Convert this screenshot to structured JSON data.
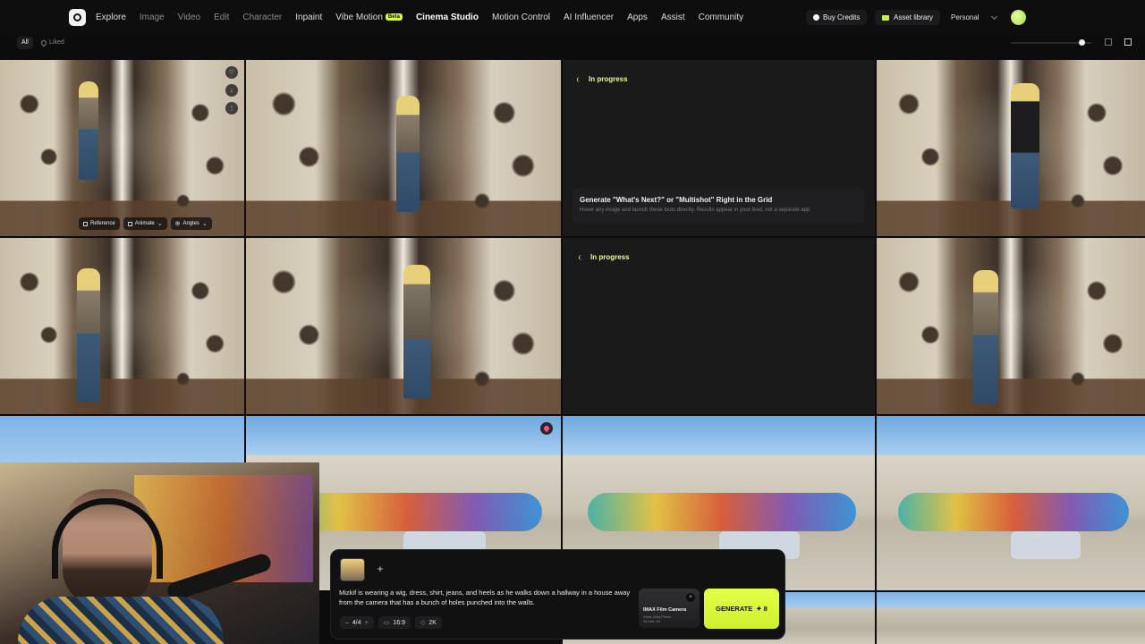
{
  "nav": {
    "items": [
      {
        "label": "Explore",
        "style": "strong"
      },
      {
        "label": "Image",
        "style": "muted"
      },
      {
        "label": "Video",
        "style": "muted"
      },
      {
        "label": "Edit",
        "style": "muted"
      },
      {
        "label": "Character",
        "style": "muted"
      },
      {
        "label": "Inpaint",
        "style": "strong"
      },
      {
        "label": "Vibe Motion",
        "style": "strong",
        "badge": "Beta"
      },
      {
        "label": "Cinema Studio",
        "style": "active"
      },
      {
        "label": "Motion Control",
        "style": "strong"
      },
      {
        "label": "AI Influencer",
        "style": "strong"
      },
      {
        "label": "Apps",
        "style": "strong"
      },
      {
        "label": "Assist",
        "style": "strong"
      },
      {
        "label": "Community",
        "style": "strong"
      }
    ],
    "buy_credits": "Buy Credits",
    "asset_library": "Asset library",
    "workspace": "Personal",
    "accent_color": "#d7ff3a"
  },
  "filters": {
    "all": "All",
    "liked": "Liked"
  },
  "grid": {
    "hover_tools": {
      "reference": "Reference",
      "animate": "Animate",
      "angles": "Angles"
    },
    "in_progress_label": "In progress",
    "tip": {
      "title": "Generate \"What's Next?\" or \"Multishot\" Right in the Grid",
      "subtitle": "Hover any image and launch these tools directly. Results appear in your feed, not a separate app"
    }
  },
  "prompt": {
    "text": "Mizkif is wearing a wig, dress, shirt, jeans, and heels as he walks down a hallway in a house away from the camera that has a bunch of holes punched into the walls.",
    "batch": "4/4",
    "aspect_ratio": "16:9",
    "resolution": "2K",
    "camera": {
      "title": "IMAX Film Camera",
      "subtitle_line1": "Zeiss Ultra Prime",
      "subtitle_line2": "35 mm, f/4"
    },
    "generate_label": "GENERATE",
    "generate_cost": "✦ 8"
  }
}
